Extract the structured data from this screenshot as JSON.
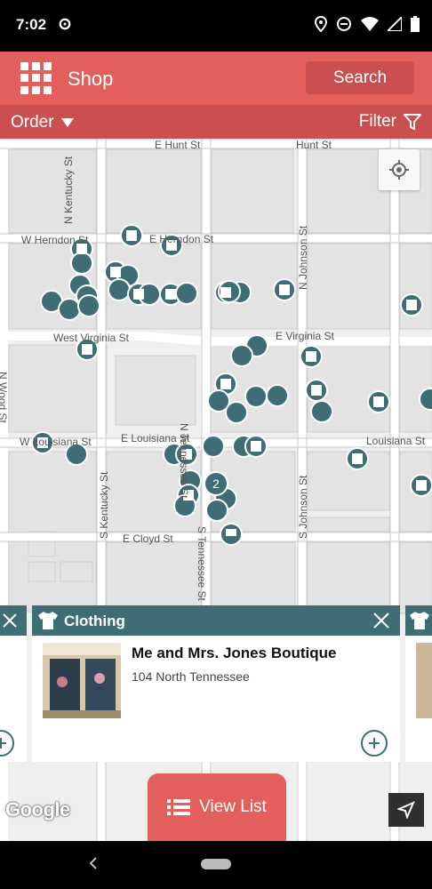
{
  "status_bar": {
    "time": "7:02",
    "icons": [
      "settings-icon",
      "location-icon",
      "do-not-disturb-icon",
      "wifi-icon",
      "signal-icon",
      "battery-icon"
    ]
  },
  "app_bar": {
    "menu_icon": "grid-menu-icon",
    "title": "Shop",
    "search_label": "Search",
    "accent_color": "#e35f5c"
  },
  "filter_bar": {
    "order_label": "Order",
    "filter_label": "Filter"
  },
  "map": {
    "streets": {
      "e_hunt_1": "E Hunt St",
      "e_hunt_2": "Hunt St",
      "w_herndon": "W Herndon St",
      "e_herndon": "E Herndon St",
      "west_virginia": "West Virginia St",
      "e_virginia": "E Virginia St",
      "n_kentucky": "N Kentucky St",
      "n_johnson": "N Johnson St",
      "n_tennessee": "N Tennessee St",
      "n_wood": "N Wood St",
      "w_louisiana": "W Louisiana St",
      "e_louisiana": "E Louisiana St",
      "louisiana": "Louisiana St",
      "s_kentucky": "S Kentucky St",
      "s_johnson": "S Johnson St",
      "e_cloyd": "E Cloyd St",
      "s_tennessee": "S Tennessee St"
    },
    "cluster_count": "2",
    "marker_color": "#3e6d75"
  },
  "card": {
    "category": "Clothing",
    "name": "Me and Mrs. Jones Boutique",
    "address": "104 North Tennessee"
  },
  "bottom": {
    "google_logo": "Google",
    "view_list_label": "View List"
  }
}
